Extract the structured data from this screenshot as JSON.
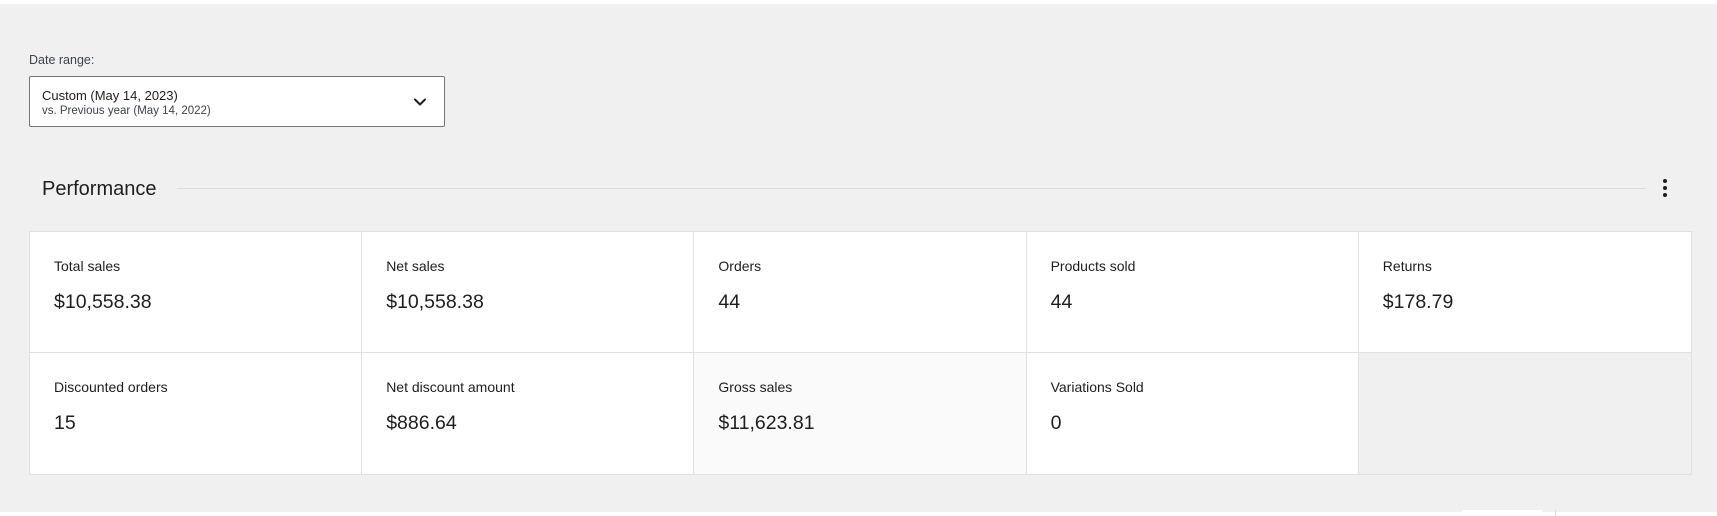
{
  "date_range": {
    "label": "Date range:",
    "primary": "Custom (May 14, 2023)",
    "secondary": "vs. Previous year (May 14, 2022)",
    "icon": "chevron-down-icon"
  },
  "performance": {
    "title": "Performance",
    "menu_icon": "more-vertical-icon",
    "cards": [
      {
        "label": "Total sales",
        "value": "$10,558.38"
      },
      {
        "label": "Net sales",
        "value": "$10,558.38"
      },
      {
        "label": "Orders",
        "value": "44"
      },
      {
        "label": "Products sold",
        "value": "44"
      },
      {
        "label": "Returns",
        "value": "$178.79"
      },
      {
        "label": "Discounted orders",
        "value": "15"
      },
      {
        "label": "Net discount amount",
        "value": "$886.64"
      },
      {
        "label": "Gross sales",
        "value": "$11,623.81"
      },
      {
        "label": "Variations Sold",
        "value": "0"
      }
    ]
  }
}
